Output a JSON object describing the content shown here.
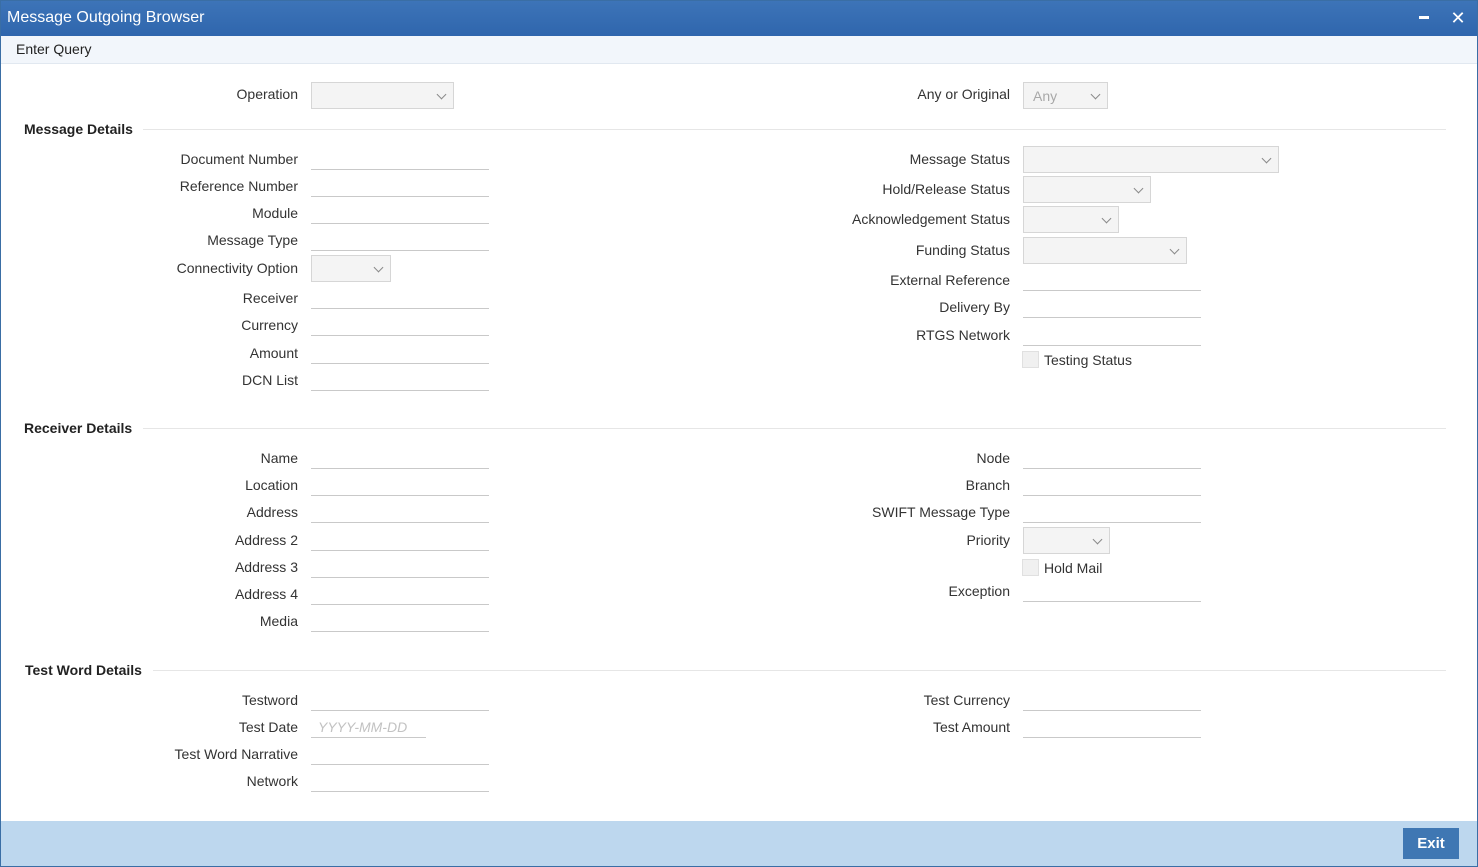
{
  "window": {
    "title": "Message Outgoing Browser"
  },
  "toolbar": {
    "enter_query": "Enter Query"
  },
  "top": {
    "operation_label": "Operation",
    "operation_value": "",
    "any_or_original_label": "Any or Original",
    "any_or_original_value": "Any"
  },
  "message_details": {
    "title": "Message Details",
    "document_number": "Document Number",
    "reference_number": "Reference Number",
    "module": "Module",
    "message_type": "Message Type",
    "connectivity_option": "Connectivity Option",
    "receiver": "Receiver",
    "currency": "Currency",
    "amount": "Amount",
    "dcn_list": "DCN List",
    "message_status": "Message Status",
    "hold_release_status": "Hold/Release Status",
    "acknowledgement_status": "Acknowledgement Status",
    "funding_status": "Funding Status",
    "external_reference": "External Reference",
    "delivery_by": "Delivery By",
    "rtgs_network": "RTGS Network",
    "testing_status": "Testing Status"
  },
  "receiver_details": {
    "title": "Receiver Details",
    "name": "Name",
    "location": "Location",
    "address": "Address",
    "address2": "Address 2",
    "address3": "Address 3",
    "address4": "Address 4",
    "media": "Media",
    "node": "Node",
    "branch": "Branch",
    "swift_message_type": "SWIFT Message Type",
    "priority": "Priority",
    "hold_mail": "Hold Mail",
    "exception": "Exception"
  },
  "test_word_details": {
    "title": "Test Word Details",
    "testword": "Testword",
    "test_date": "Test Date",
    "test_date_placeholder": "YYYY-MM-DD",
    "test_word_narrative": "Test Word Narrative",
    "network": "Network",
    "test_currency": "Test Currency",
    "test_amount": "Test Amount"
  },
  "footer": {
    "exit_label": "Exit"
  },
  "colors": {
    "titlebar": "#2f66ad",
    "footer": "#bdd7ee",
    "button": "#3f77b3"
  }
}
